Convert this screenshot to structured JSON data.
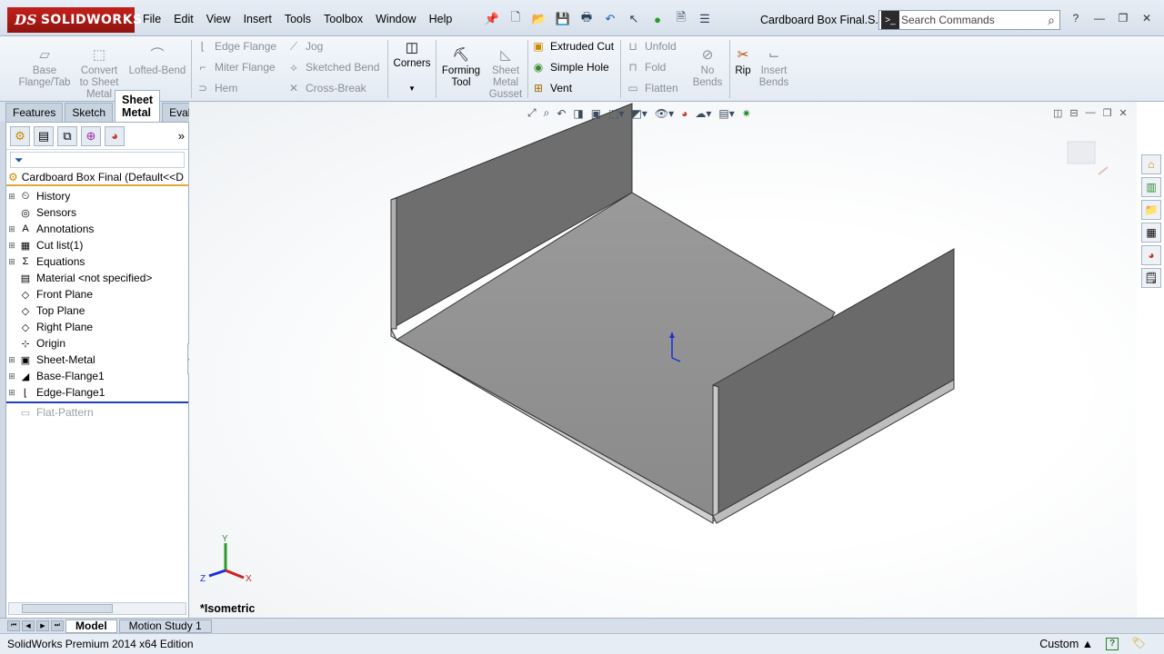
{
  "app": {
    "brand": "SOLIDWORKS",
    "brand_prefix": "DS",
    "document_title": "Cardboard Box Final.S..."
  },
  "menu": [
    "File",
    "Edit",
    "View",
    "Insert",
    "Tools",
    "Toolbox",
    "Window",
    "Help"
  ],
  "search": {
    "placeholder": "Search Commands"
  },
  "ribbon": {
    "base_flange": "Base\nFlange/Tab",
    "convert": "Convert\nto Sheet\nMetal",
    "lofted_bend": "Lofted-Bend",
    "edge_flange": "Edge Flange",
    "miter_flange": "Miter Flange",
    "hem": "Hem",
    "jog": "Jog",
    "sketched_bend": "Sketched Bend",
    "cross_break": "Cross-Break",
    "corners": "Corners",
    "forming_tool": "Forming\nTool",
    "gusset": "Sheet\nMetal\nGusset",
    "extruded_cut": "Extruded Cut",
    "simple_hole": "Simple Hole",
    "vent": "Vent",
    "unfold": "Unfold",
    "fold": "Fold",
    "flatten": "Flatten",
    "no_bends": "No\nBends",
    "rip": "Rip",
    "insert_bends": "Insert\nBends"
  },
  "tabs": [
    "Features",
    "Sketch",
    "Sheet Metal",
    "Evaluate"
  ],
  "active_tab": "Sheet Metal",
  "tree": {
    "root": "Cardboard Box Final  (Default<<D",
    "items": [
      {
        "label": "History",
        "icon": "history-icon",
        "expandable": true
      },
      {
        "label": "Sensors",
        "icon": "sensors-icon",
        "expandable": false
      },
      {
        "label": "Annotations",
        "icon": "annotations-icon",
        "expandable": true
      },
      {
        "label": "Cut list(1)",
        "icon": "cut-list-icon",
        "expandable": true
      },
      {
        "label": "Equations",
        "icon": "equations-icon",
        "expandable": true
      },
      {
        "label": "Material <not specified>",
        "icon": "material-icon",
        "expandable": false
      },
      {
        "label": "Front Plane",
        "icon": "plane-icon",
        "expandable": false
      },
      {
        "label": "Top Plane",
        "icon": "plane-icon",
        "expandable": false
      },
      {
        "label": "Right Plane",
        "icon": "plane-icon",
        "expandable": false
      },
      {
        "label": "Origin",
        "icon": "origin-icon",
        "expandable": false
      },
      {
        "label": "Sheet-Metal",
        "icon": "sheet-metal-icon",
        "expandable": true
      },
      {
        "label": "Base-Flange1",
        "icon": "base-flange-icon",
        "expandable": true
      },
      {
        "label": "Edge-Flange1",
        "icon": "edge-flange-icon",
        "expandable": true
      },
      {
        "label": "Flat-Pattern",
        "icon": "flat-pattern-icon",
        "expandable": false,
        "suppressed": true
      }
    ]
  },
  "viewport": {
    "view_label": "*Isometric",
    "triad": {
      "x": "X",
      "y": "Y",
      "z": "Z"
    }
  },
  "bottom_tabs": [
    "Model",
    "Motion Study 1"
  ],
  "status": {
    "left": "SolidWorks Premium 2014 x64 Edition",
    "units": "Custom"
  },
  "colors": {
    "accent_red": "#b51c17",
    "model_gray": "#8e8e8e",
    "rollback_bar": "#1d3fb5"
  }
}
